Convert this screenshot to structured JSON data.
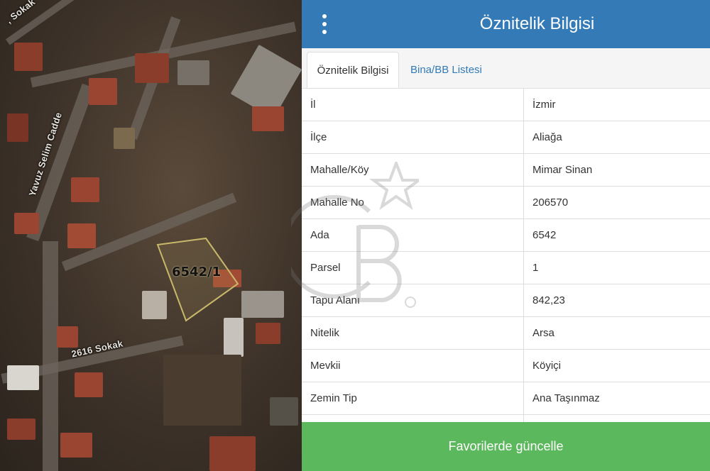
{
  "map": {
    "parcel_label": "6542/1",
    "street_labels": [
      "Yavuz Selim Cadde",
      "2616 Sokak",
      ", Sokak"
    ]
  },
  "panel": {
    "title": "Öznitelik Bilgisi",
    "tabs": [
      {
        "label": "Öznitelik Bilgisi",
        "active": true
      },
      {
        "label": "Bina/BB Listesi",
        "active": false
      }
    ],
    "rows": [
      {
        "key": "İl",
        "value": "İzmir"
      },
      {
        "key": "İlçe",
        "value": "Aliağa"
      },
      {
        "key": "Mahalle/Köy",
        "value": "Mimar Sinan"
      },
      {
        "key": "Mahalle No",
        "value": "206570"
      },
      {
        "key": "Ada",
        "value": "6542"
      },
      {
        "key": "Parsel",
        "value": "1"
      },
      {
        "key": "Tapu Alanı",
        "value": "842,23"
      },
      {
        "key": "Nitelik",
        "value": "Arsa"
      },
      {
        "key": "Mevkii",
        "value": "Köyiçi"
      },
      {
        "key": "Zemin Tip",
        "value": "Ana Taşınmaz"
      }
    ],
    "footer_button": "Favorilerde güncelle"
  },
  "colors": {
    "header": "#337ab7",
    "button": "#5cb85c",
    "parcel_outline": "#c9b86a"
  },
  "icons": {
    "menu": "kebab-menu-icon",
    "watermark": "cb-logo-watermark"
  }
}
